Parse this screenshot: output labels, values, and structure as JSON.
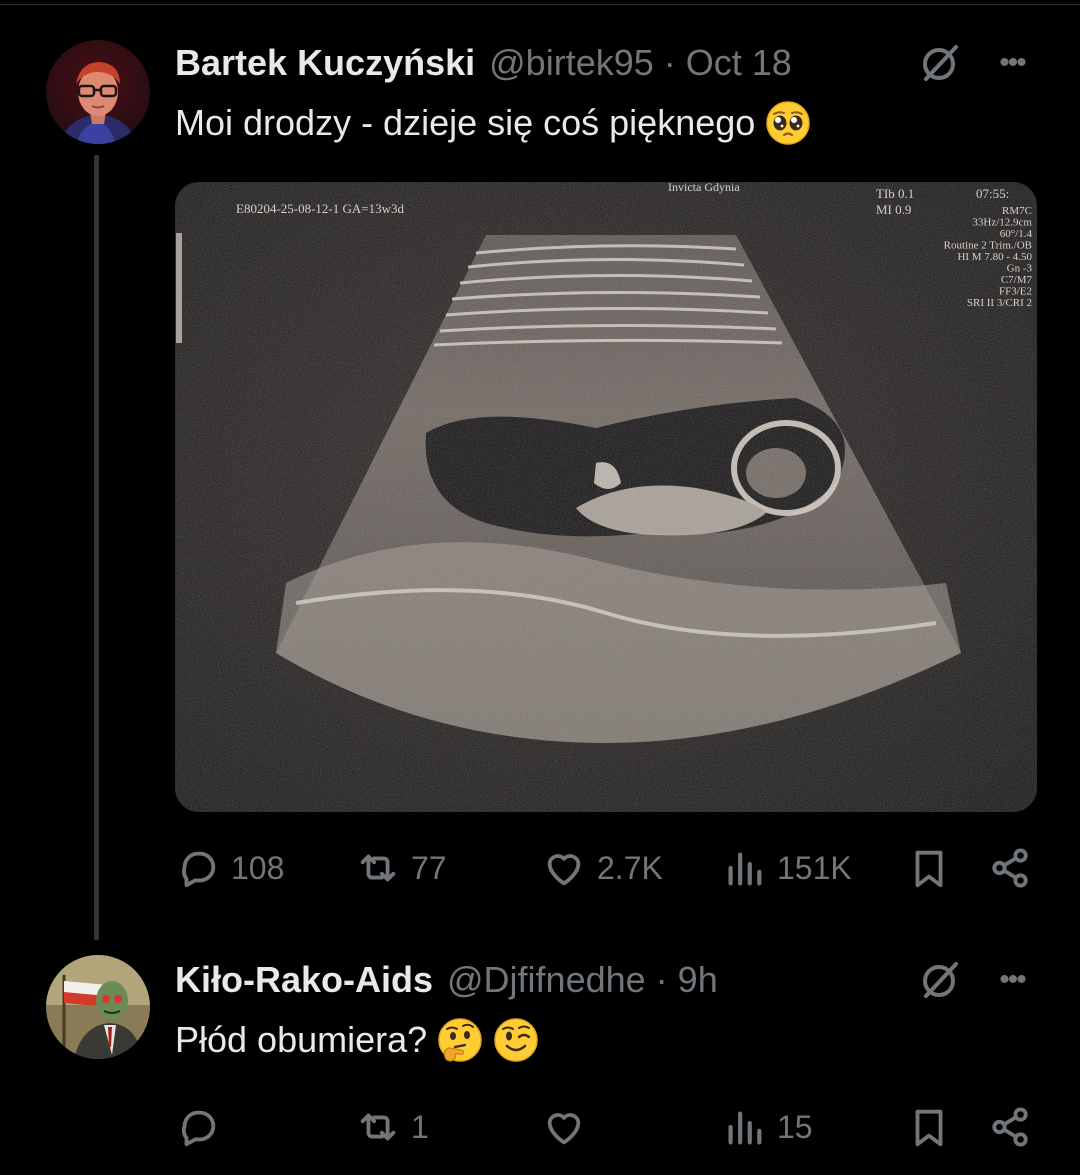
{
  "posts": [
    {
      "author": {
        "name": "Bartek Kuczyński",
        "handle": "@birtek95",
        "time": "Oct 18"
      },
      "text": "Moi drodzy - dzieje się coś pięknego",
      "text_emoji": [
        "pleading-face-emoji"
      ],
      "media": {
        "type": "ultrasound-image",
        "overlay_left": "E80204-25-08-12-1  GA=13w3d",
        "overlay_top": "Invicta Gdynia",
        "overlay_tib": "TIb  0.1",
        "overlay_mi": "MI  0.9",
        "overlay_time": "07:55:",
        "overlay_right_lines": [
          "RM7C",
          "33Hz/12.9cm",
          "60°/1.4",
          "Routine 2 Trim./OB",
          "HI M  7.80 - 4.50",
          "Gn  -3",
          "C7/M7",
          "FF3/E2",
          "SRI II 3/CRI 2"
        ]
      },
      "actions": {
        "replies": "108",
        "reposts": "77",
        "likes": "2.7K",
        "views": "151K"
      }
    },
    {
      "author": {
        "name": "Kiło-Rako-Aids",
        "handle": "@Djfifnedhe",
        "time": "9h"
      },
      "text": "Płód obumiera?",
      "text_emoji": [
        "thinking-face-emoji",
        "winking-face-emoji"
      ],
      "actions": {
        "replies": "",
        "reposts": "1",
        "likes": "",
        "views": "15"
      }
    }
  ],
  "separator": "·",
  "icons": {
    "reply": "reply-icon",
    "repost": "repost-icon",
    "like": "heart-icon",
    "views": "views-icon",
    "bookmark": "bookmark-icon",
    "share": "share-icon",
    "grok": "grok-icon",
    "more": "more-icon"
  },
  "colors": {
    "background": "#000000",
    "text": "#e7e9ea",
    "muted": "#71767b",
    "thread_line": "#333639"
  }
}
